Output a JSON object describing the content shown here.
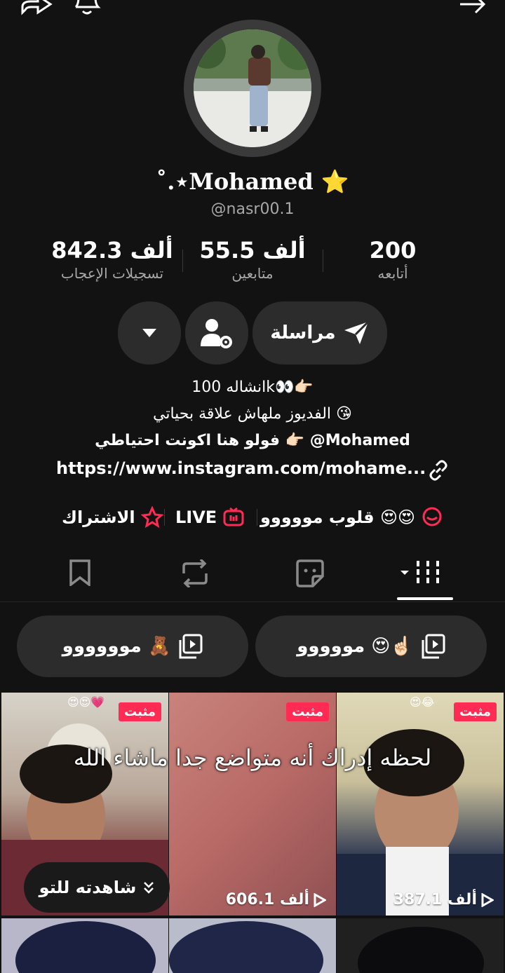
{
  "profile": {
    "name": "˚.⋆Mohamed ⭐",
    "handle": "@nasr00.1"
  },
  "stats": [
    {
      "value": "200",
      "label": "أتابعه"
    },
    {
      "value": "55.5 ألف",
      "label": "متابعين"
    },
    {
      "value": "842.3 ألف",
      "label": "تسجيلات الإعجاب"
    }
  ],
  "actions": {
    "message_label": "مراسلة"
  },
  "bio": {
    "line1": "انشاله 100k👀👉🏻",
    "line2": "الفديوز ملهاش علاقة بحياتي 😘",
    "line3": "فولو هنا اكونت احتياطي  👉🏻  @Mohamed",
    "link": "https://www.instagram.com/mohame..."
  },
  "tags": {
    "hearts": "قلوب مووووو 😍😍",
    "live": "LIVE",
    "subscribe": "الاشتراك"
  },
  "playlists": [
    {
      "label": "مووووو 😍☝🏻"
    },
    {
      "label": "موووووو 🧸"
    }
  ],
  "videos": [
    {
      "pin_label": "مثبت",
      "views": "606.1 ألف",
      "emoji": "😍😍💗"
    },
    {
      "pin_label": "مثبت",
      "views": "",
      "emoji": ""
    },
    {
      "pin_label": "مثبت",
      "views": "387.1 ألف",
      "emoji": "😍😂"
    }
  ],
  "overlay_caption": "لحظه إدراك أنه متواضع جدا ماشاء الله",
  "watched_label": "شاهدته للتو",
  "colors": {
    "accent": "#ff2b55",
    "background": "#121212",
    "pill": "#2c2c2c"
  }
}
